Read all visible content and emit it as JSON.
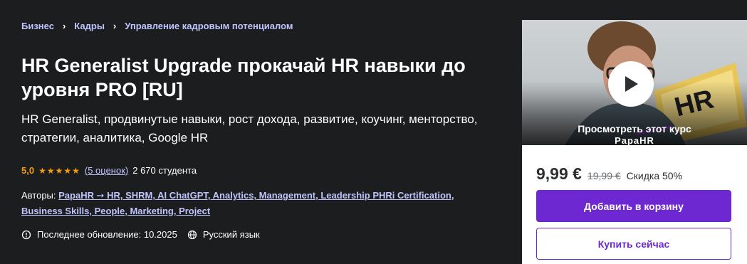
{
  "breadcrumb": [
    "Бизнес",
    "Кадры",
    "Управление кадровым потенциалом"
  ],
  "course": {
    "title": "HR Generalist Upgrade прокачай HR навыки до уровня PRO [RU]",
    "subtitle": "HR Generalist, продвинутые навыки, рост дохода, развитие, коучинг, менторство, стратегии, аналитика, Google HR",
    "rating": "5,0",
    "rating_stars": 5,
    "reviews_link": "(5 оценок)",
    "students": "2 670 студента",
    "authors_label": "Авторы:",
    "authors_line1": "PapaHR ➙ HR, SHRM, AI ChatGPT, Analytics, Management, Leadership PHRi Certification,",
    "authors_line2": "Business Skills, People, Marketing, Project",
    "last_updated": "Последнее обновление: 10.2025",
    "language": "Русский язык"
  },
  "sidebar": {
    "preview_label": "Просмотреть этот курс",
    "watermark": "PapaHR",
    "price": "9,99 €",
    "old_price": "19,99 €",
    "discount": "Скидка 50%",
    "add_to_cart": "Добавить в корзину",
    "buy_now": "Купить сейчас"
  },
  "colors": {
    "accent": "#6d28d2",
    "rating": "#f69c08",
    "link": "#c0c4fc",
    "background": "#1c1d1f"
  }
}
